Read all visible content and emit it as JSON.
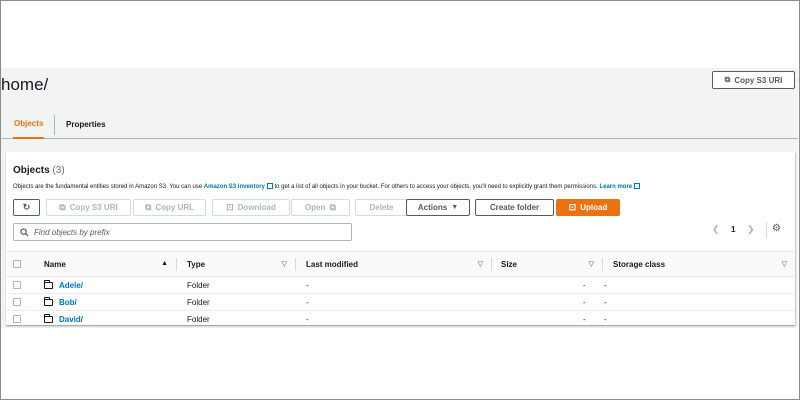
{
  "header": {
    "title": "home/",
    "copy_uri_label": "Copy S3 URI"
  },
  "tabs": [
    {
      "label": "Objects",
      "active": true
    },
    {
      "label": "Properties",
      "active": false
    }
  ],
  "panel": {
    "title": "Objects",
    "count": "(3)",
    "desc_prefix": "Objects are the fundamental entities stored in Amazon S3. You can use ",
    "desc_link1": "Amazon S3 inventory",
    "desc_middle": " to get a list of all objects in your bucket. For others to access your objects, you'll need to explicitly grant them permissions. ",
    "desc_link2": "Learn more"
  },
  "toolbar": {
    "copy_s3_uri": "Copy S3 URI",
    "copy_url": "Copy URL",
    "download": "Download",
    "open": "Open",
    "delete": "Delete",
    "actions": "Actions",
    "create_folder": "Create folder",
    "upload": "Upload"
  },
  "search": {
    "placeholder": "Find objects by prefix",
    "value": ""
  },
  "pagination": {
    "page": "1"
  },
  "table": {
    "columns": [
      "Name",
      "Type",
      "Last modified",
      "Size",
      "Storage class"
    ],
    "rows": [
      {
        "name": "Adele/",
        "type": "Folder",
        "last_modified": "-",
        "size": "-",
        "storage_class": "-"
      },
      {
        "name": "Bob/",
        "type": "Folder",
        "last_modified": "-",
        "size": "-",
        "storage_class": "-"
      },
      {
        "name": "David/",
        "type": "Folder",
        "last_modified": "-",
        "size": "-",
        "storage_class": "-"
      }
    ]
  },
  "colors": {
    "accent": "#ec7211",
    "link": "#0073bb",
    "background": "#f2f3f3"
  },
  "icons": [
    "refresh-icon",
    "copy-icon",
    "download-icon",
    "external-link-icon",
    "caret-down-icon",
    "upload-icon",
    "search-icon",
    "chevron-left-icon",
    "chevron-right-icon",
    "gear-icon",
    "folder-icon",
    "sort-icon"
  ]
}
